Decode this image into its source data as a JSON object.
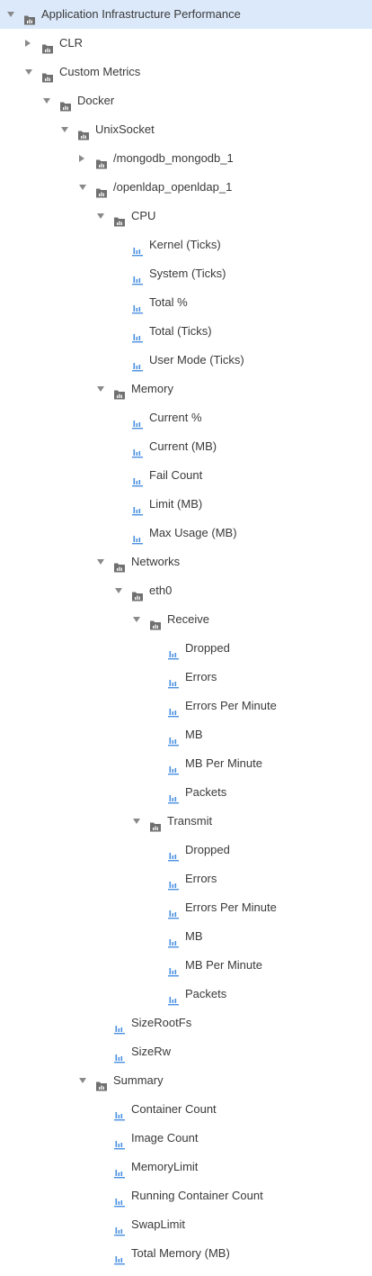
{
  "colors": {
    "selected_bg": "#dce9fb",
    "folder_icon": "#707070",
    "metric_icon": "#4a90e2",
    "arrow": "#8a8a8a",
    "text": "#3a3a3a"
  },
  "tree": [
    {
      "label": "Application Infrastructure Performance",
      "level": 0,
      "kind": "folder",
      "state": "expanded",
      "selected": true
    },
    {
      "label": "CLR",
      "level": 1,
      "kind": "folder",
      "state": "collapsed"
    },
    {
      "label": "Custom Metrics",
      "level": 1,
      "kind": "folder",
      "state": "expanded"
    },
    {
      "label": "Docker",
      "level": 2,
      "kind": "folder",
      "state": "expanded"
    },
    {
      "label": "UnixSocket",
      "level": 3,
      "kind": "folder",
      "state": "expanded"
    },
    {
      "label": "/mongodb_mongodb_1",
      "level": 4,
      "kind": "folder",
      "state": "collapsed"
    },
    {
      "label": "/openldap_openldap_1",
      "level": 4,
      "kind": "folder",
      "state": "expanded"
    },
    {
      "label": "CPU",
      "level": 5,
      "kind": "folder",
      "state": "expanded"
    },
    {
      "label": "Kernel (Ticks)",
      "level": 6,
      "kind": "metric"
    },
    {
      "label": "System (Ticks)",
      "level": 6,
      "kind": "metric"
    },
    {
      "label": "Total %",
      "level": 6,
      "kind": "metric"
    },
    {
      "label": "Total (Ticks)",
      "level": 6,
      "kind": "metric"
    },
    {
      "label": "User Mode (Ticks)",
      "level": 6,
      "kind": "metric"
    },
    {
      "label": "Memory",
      "level": 5,
      "kind": "folder",
      "state": "expanded"
    },
    {
      "label": "Current %",
      "level": 6,
      "kind": "metric"
    },
    {
      "label": "Current (MB)",
      "level": 6,
      "kind": "metric"
    },
    {
      "label": "Fail Count",
      "level": 6,
      "kind": "metric"
    },
    {
      "label": "Limit (MB)",
      "level": 6,
      "kind": "metric"
    },
    {
      "label": "Max Usage (MB)",
      "level": 6,
      "kind": "metric"
    },
    {
      "label": "Networks",
      "level": 5,
      "kind": "folder",
      "state": "expanded"
    },
    {
      "label": "eth0",
      "level": 6,
      "kind": "folder",
      "state": "expanded"
    },
    {
      "label": "Receive",
      "level": 7,
      "kind": "folder",
      "state": "expanded"
    },
    {
      "label": "Dropped",
      "level": 8,
      "kind": "metric"
    },
    {
      "label": "Errors",
      "level": 8,
      "kind": "metric"
    },
    {
      "label": "Errors Per Minute",
      "level": 8,
      "kind": "metric"
    },
    {
      "label": "MB",
      "level": 8,
      "kind": "metric"
    },
    {
      "label": "MB Per Minute",
      "level": 8,
      "kind": "metric"
    },
    {
      "label": "Packets",
      "level": 8,
      "kind": "metric"
    },
    {
      "label": "Transmit",
      "level": 7,
      "kind": "folder",
      "state": "expanded"
    },
    {
      "label": "Dropped",
      "level": 8,
      "kind": "metric"
    },
    {
      "label": "Errors",
      "level": 8,
      "kind": "metric"
    },
    {
      "label": "Errors Per Minute",
      "level": 8,
      "kind": "metric"
    },
    {
      "label": "MB",
      "level": 8,
      "kind": "metric"
    },
    {
      "label": "MB Per Minute",
      "level": 8,
      "kind": "metric"
    },
    {
      "label": "Packets",
      "level": 8,
      "kind": "metric"
    },
    {
      "label": "SizeRootFs",
      "level": 5,
      "kind": "metric"
    },
    {
      "label": "SizeRw",
      "level": 5,
      "kind": "metric"
    },
    {
      "label": "Summary",
      "level": 4,
      "kind": "folder",
      "state": "expanded"
    },
    {
      "label": "Container Count",
      "level": 5,
      "kind": "metric"
    },
    {
      "label": "Image Count",
      "level": 5,
      "kind": "metric"
    },
    {
      "label": "MemoryLimit",
      "level": 5,
      "kind": "metric"
    },
    {
      "label": "Running Container Count",
      "level": 5,
      "kind": "metric"
    },
    {
      "label": "SwapLimit",
      "level": 5,
      "kind": "metric"
    },
    {
      "label": "Total Memory (MB)",
      "level": 5,
      "kind": "metric"
    }
  ]
}
